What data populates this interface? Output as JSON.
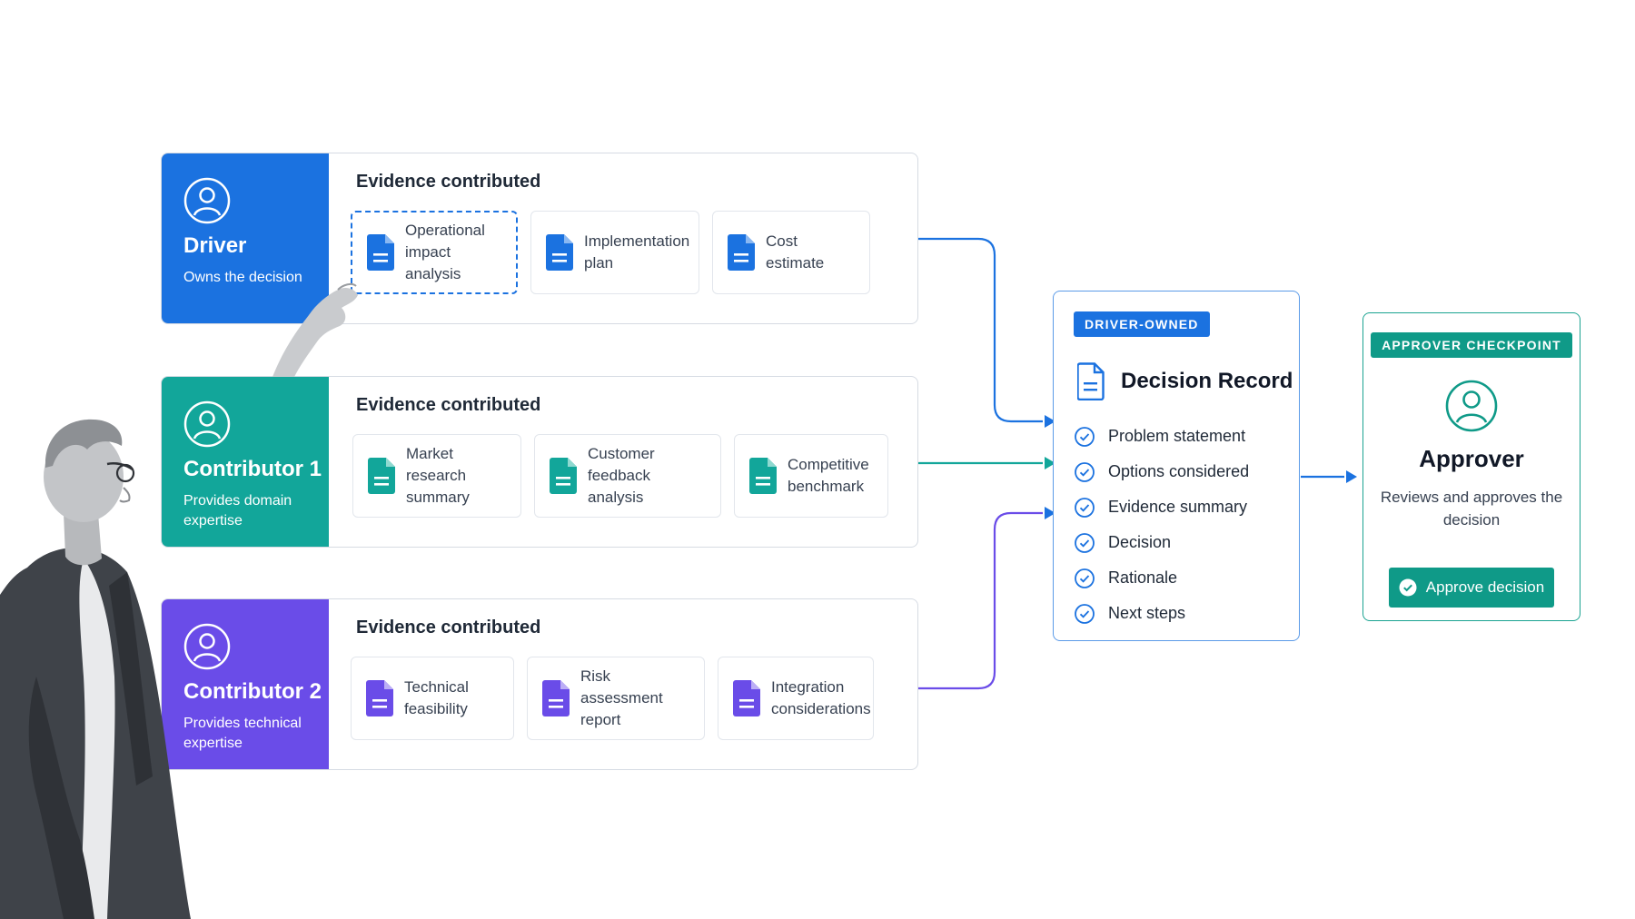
{
  "roles": [
    {
      "key": "driver",
      "title": "Driver",
      "subtitle": "Owns the decision",
      "color": "#1b72e0",
      "evidence_title": "Evidence contributed",
      "documents": [
        {
          "label": "Operational impact analysis",
          "selected": true
        },
        {
          "label": "Implementation plan",
          "selected": false
        },
        {
          "label": "Cost estimate",
          "selected": false
        }
      ]
    },
    {
      "key": "contributor-1",
      "title": "Contributor 1",
      "subtitle": "Provides domain expertise",
      "color": "#12a69a",
      "evidence_title": "Evidence contributed",
      "documents": [
        {
          "label": "Market research summary",
          "selected": false
        },
        {
          "label": "Customer feedback analysis",
          "selected": false
        },
        {
          "label": "Competitive benchmark",
          "selected": false
        }
      ]
    },
    {
      "key": "contributor-2",
      "title": "Contributor 2",
      "subtitle": "Provides technical expertise",
      "color": "#6a4ce8",
      "evidence_title": "Evidence contributed",
      "documents": [
        {
          "label": "Technical feasibility",
          "selected": false
        },
        {
          "label": "Risk assessment report",
          "selected": false
        },
        {
          "label": "Integration considerations",
          "selected": false
        }
      ]
    }
  ],
  "decision_record": {
    "badge": "DRIVER-OWNED",
    "title": "Decision Record",
    "items": [
      "Problem statement",
      "Options considered",
      "Evidence summary",
      "Decision",
      "Rationale",
      "Next steps"
    ]
  },
  "approver": {
    "badge": "APPROVER CHECKPOINT",
    "title": "Approver",
    "subtitle": "Reviews and approves the decision",
    "button_label": "Approve decision"
  },
  "colors": {
    "driver": "#1b72e0",
    "contributor_1": "#12a69a",
    "contributor_2": "#6a4ce8",
    "approver": "#0f9a88"
  }
}
